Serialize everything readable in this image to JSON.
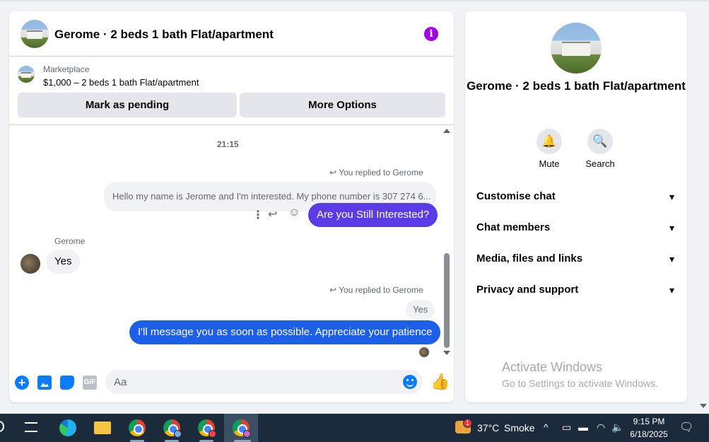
{
  "chat": {
    "title": "Gerome · 2 beds 1 bath Flat/apartment",
    "marketplace_label": "Marketplace",
    "listing": "$1,000 – 2 beds 1 bath Flat/apartment",
    "mark_pending_label": "Mark as pending",
    "more_options_label": "More Options",
    "timestamp": "21:15",
    "replied_1": "You replied to Gerome",
    "quoted_1": "Hello my name is Jerome and I'm interested. My phone number is 307 274 6...",
    "sent_1": "Are you Still Interested?",
    "sender_name": "Gerome",
    "received_1": "Yes",
    "replied_2": "You replied to Gerome",
    "quoted_2": "Yes",
    "sent_2": "I'll message you as soon as possible. Appreciate your patience",
    "input_placeholder": "Aa",
    "gif_label": "GIF"
  },
  "info_panel": {
    "title": "Gerome · 2 beds 1 bath Flat/apartment",
    "mute_label": "Mute",
    "search_label": "Search",
    "menu": [
      "Customise chat",
      "Chat members",
      "Media, files and links",
      "Privacy and support"
    ]
  },
  "watermark": {
    "line1": "Activate Windows",
    "line2": "Go to Settings to activate Windows."
  },
  "taskbar": {
    "weather_temp": "37°C",
    "weather_desc": "Smoke",
    "weather_badge": "1",
    "time": "9:15 PM",
    "date": "6/18/2025"
  },
  "colors": {
    "accent": "#0a7cff",
    "sent_bubble": "#1d5fe6",
    "info_icon": "#a100e8"
  }
}
